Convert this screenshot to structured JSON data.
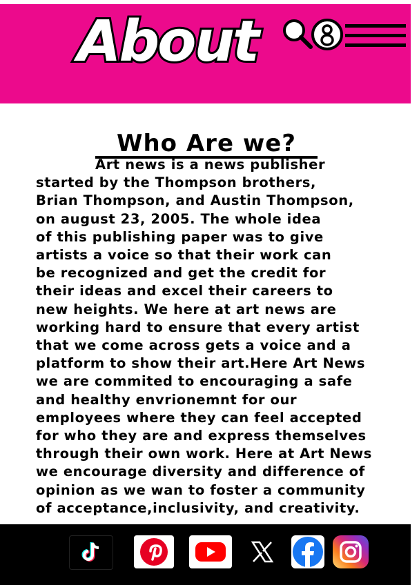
{
  "header": {
    "logo_text": "About",
    "background_color": "#ec0a8c",
    "icons": [
      "search-icon",
      "user-icon",
      "menu-icon"
    ]
  },
  "main": {
    "title": "Who Are we?",
    "paragraph_lines": [
      "Art news is a news publisher",
      "started by the Thompson brothers,",
      "Brian Thompson, and Austin Thompson,",
      "on august 23, 2005. The whole idea",
      "of this publishing  paper was to give",
      "artists a voice so that their work can",
      "be recognized and get the credit for",
      "their ideas and excel their careers to",
      "new heights. We here at art news are",
      "working hard to ensure that every artist",
      "that we come across gets a voice and a",
      "platform to show their art.Here Art News",
      "we are commited to encouraging a safe",
      "and healthy envrionemnt for our",
      "employees where they can feel accepted",
      "for who they are and express themselves",
      "through their own work. Here at Art News",
      "we encourage diversity and difference of",
      "opinion as we wan to foster a community",
      "of acceptance,inclusivity, and creativity."
    ]
  },
  "footer": {
    "background_color": "#000000",
    "social_icons": [
      "tiktok-icon",
      "pinterest-icon",
      "youtube-icon",
      "x-icon",
      "facebook-icon",
      "instagram-icon"
    ]
  }
}
